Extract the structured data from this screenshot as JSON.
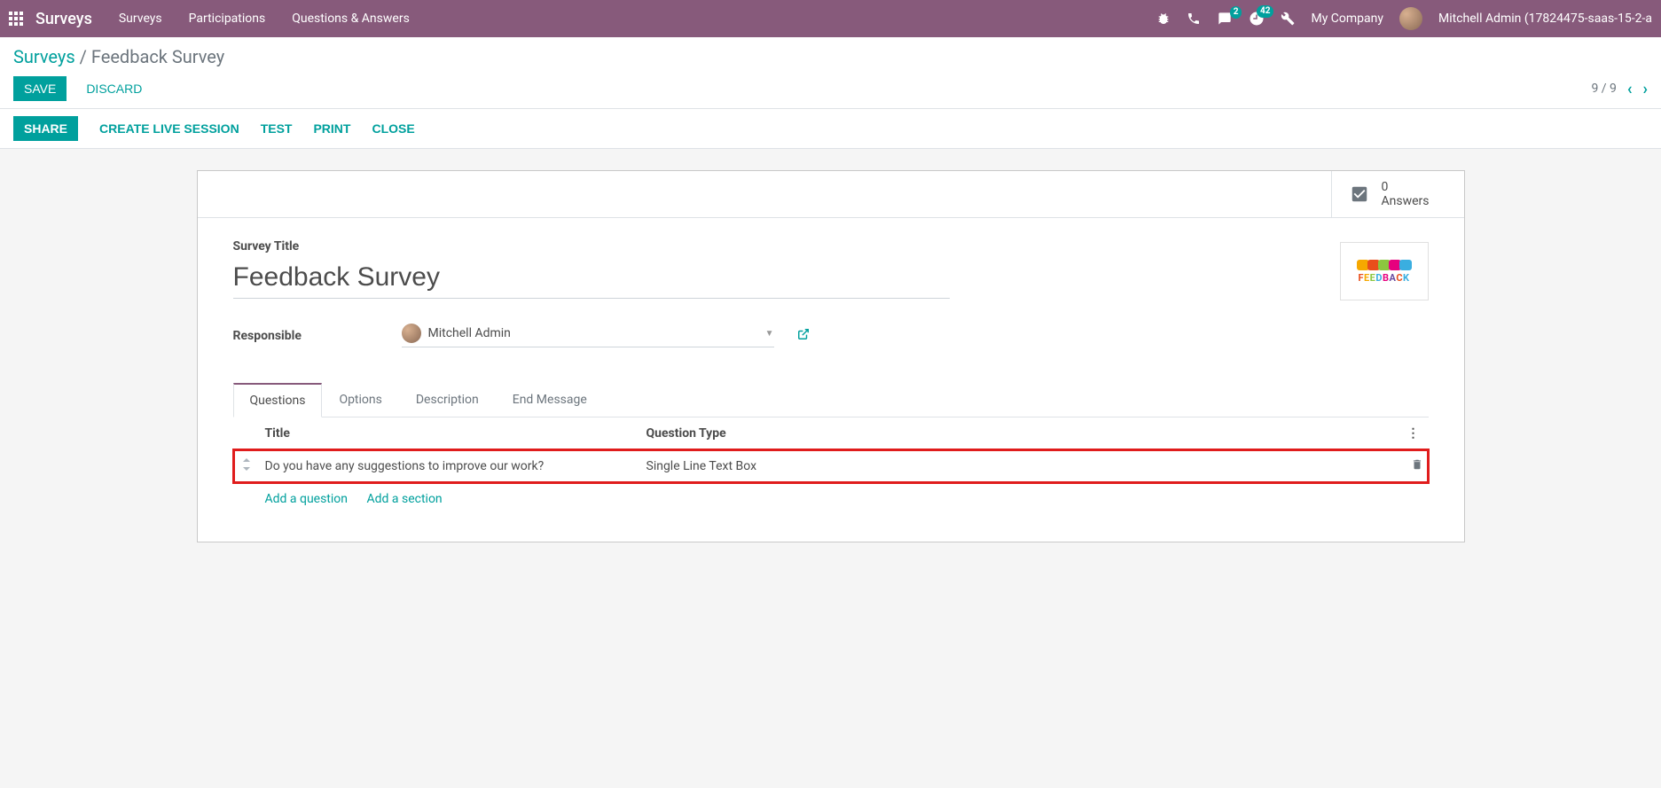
{
  "nav": {
    "brand": "Surveys",
    "menu": [
      "Surveys",
      "Participations",
      "Questions & Answers"
    ],
    "chat_badge": "2",
    "activity_badge": "42",
    "company": "My Company",
    "user": "Mitchell Admin (17824475-saas-15-2-a"
  },
  "breadcrumb": {
    "root": "Surveys",
    "current": "Feedback Survey"
  },
  "buttons": {
    "save": "SAVE",
    "discard": "DISCARD",
    "share": "SHARE",
    "live": "CREATE LIVE SESSION",
    "test": "TEST",
    "print": "PRINT",
    "close": "CLOSE"
  },
  "pager": {
    "text": "9 / 9"
  },
  "stat": {
    "count": "0",
    "label": "Answers"
  },
  "form": {
    "title_label": "Survey Title",
    "title_value": "Feedback Survey",
    "responsible_label": "Responsible",
    "responsible_value": "Mitchell Admin",
    "feedback_caption": "FEEDBACK"
  },
  "tabs": [
    "Questions",
    "Options",
    "Description",
    "End Message"
  ],
  "table": {
    "headers": {
      "title": "Title",
      "type": "Question Type"
    },
    "rows": [
      {
        "title": "Do you have any suggestions to improve our work?",
        "type": "Single Line Text Box"
      }
    ],
    "add_q": "Add a question",
    "add_s": "Add a section"
  }
}
